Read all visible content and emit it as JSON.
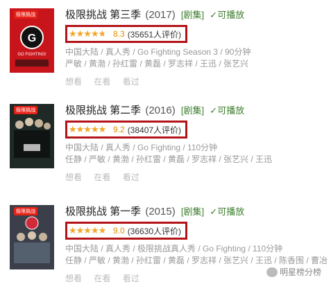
{
  "entries": [
    {
      "title": "极限挑战 第三季",
      "year": "(2017)",
      "tag": "[剧集]",
      "play": "可播放",
      "rating_fraction": 0.83,
      "score": "8.3",
      "count": "(35651人评价)",
      "meta_line1": "中国大陆 / 真人秀 / Go Fighting Season 3 / 90分钟",
      "meta_line2": "严敏 / 黄渤 / 孙红雷 / 黄磊 / 罗志祥 / 王迅 / 张艺兴",
      "actions": [
        "想看",
        "在看",
        "看过"
      ],
      "poster_badge": "极限挑战",
      "poster_text": "GO FIGHTING!",
      "poster_color": "#c8151b"
    },
    {
      "title": "极限挑战 第二季",
      "year": "(2016)",
      "tag": "[剧集]",
      "play": "可播放",
      "rating_fraction": 0.92,
      "score": "9.2",
      "count": "(38407人评价)",
      "meta_line1": "中国大陆 / 真人秀 / Go Fighting / 110分钟",
      "meta_line2": "任静 / 严敏 / 黄渤 / 孙红雷 / 黄磊 / 罗志祥 / 张艺兴 / 王迅",
      "actions": [
        "想看",
        "在看",
        "看过"
      ],
      "poster_badge": "极限挑战",
      "poster_text": "",
      "poster_color": "#1f2a26"
    },
    {
      "title": "极限挑战 第一季",
      "year": "(2015)",
      "tag": "[剧集]",
      "play": "可播放",
      "rating_fraction": 0.9,
      "score": "9.0",
      "count": "(36630人评价)",
      "meta_line1": "中国大陆 / 真人秀 / 极限挑战真人秀 / Go Fighting / 110分钟",
      "meta_line2": "任静 / 严敏 / 黄渤 / 孙红雷 / 黄磊 / 罗志祥 / 张艺兴 / 王迅 / 陈香围 / 曹冶",
      "actions": [
        "想看",
        "在看",
        "看过"
      ],
      "poster_badge": "极限挑战",
      "poster_text": "",
      "poster_color": "#3a3f4a"
    }
  ],
  "watermark": "明星榜分榜",
  "colors": {
    "highlight_border": "#b31217",
    "star": "#f5a623",
    "score": "#e09000",
    "tag_green": "#3b7d2b"
  }
}
